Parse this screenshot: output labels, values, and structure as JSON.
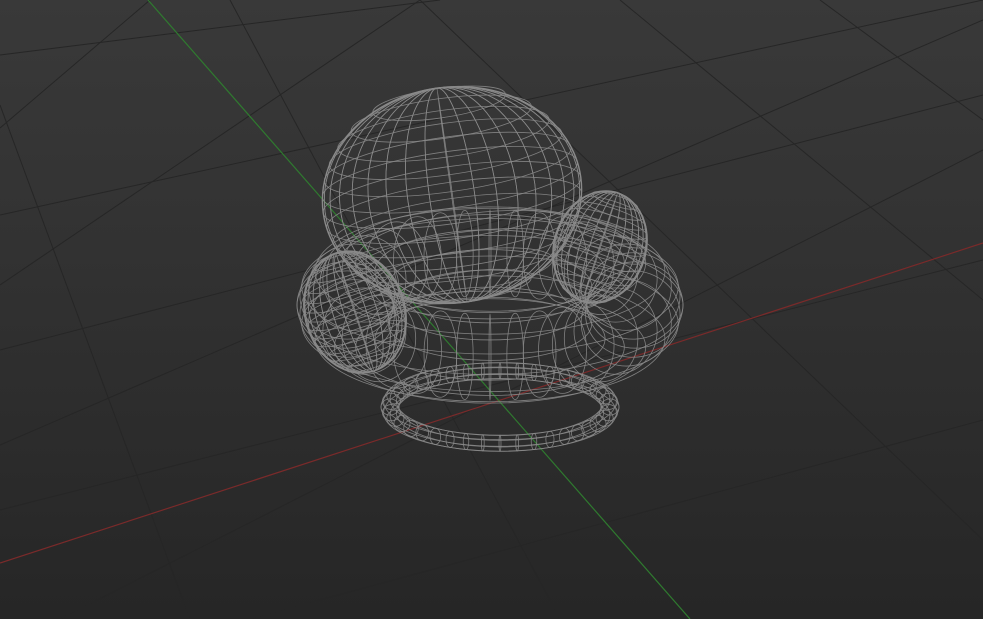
{
  "viewport": {
    "name": "3D viewport",
    "shading_mode": "wireframe",
    "mesh_color": "#8a8a8a",
    "grid_color": "#262626",
    "background_top": "#393939",
    "background_bottom": "#262626"
  },
  "axes": {
    "x_axis_color": "#7a2a2a",
    "y_axis_color": "#2f7a2f"
  },
  "object": {
    "parts": [
      "head-sphere",
      "left-ear",
      "right-ear",
      "body-torus",
      "base-ring"
    ]
  }
}
